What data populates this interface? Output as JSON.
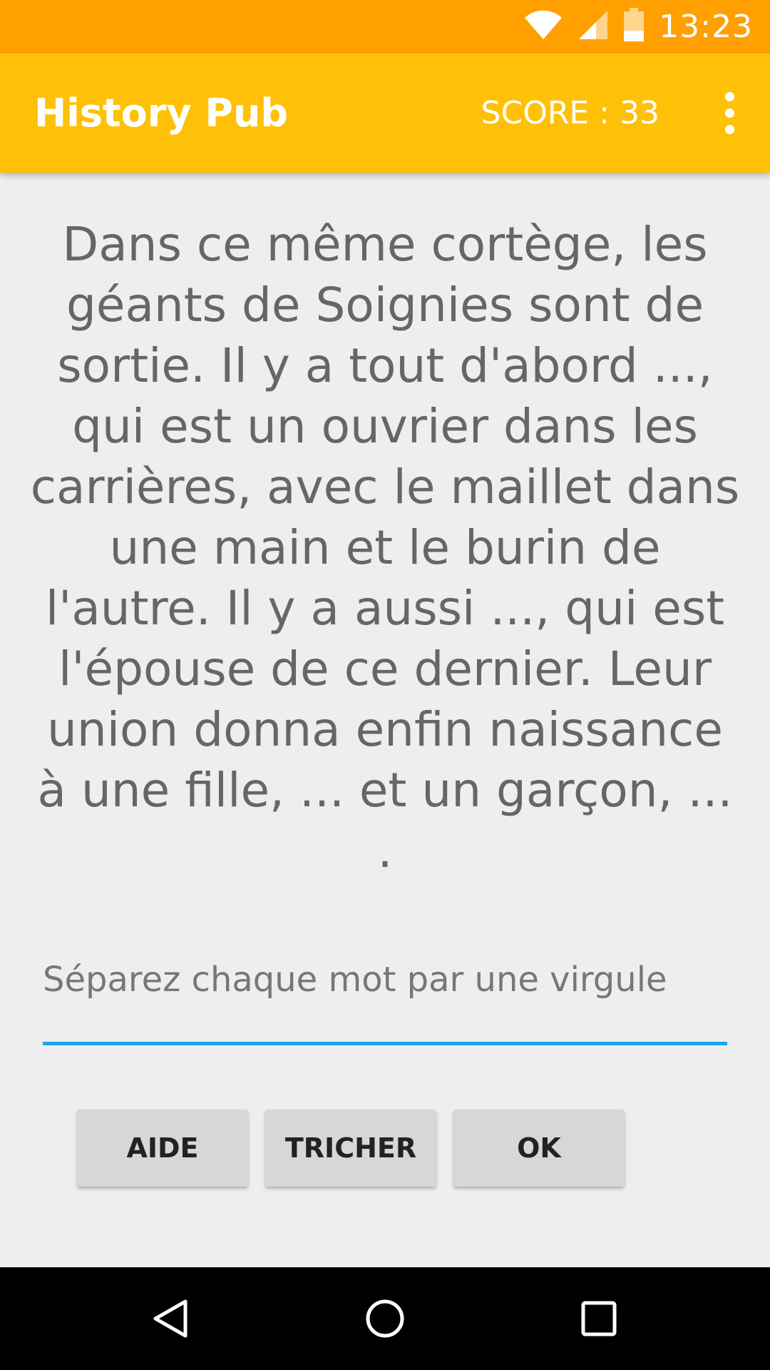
{
  "status_bar": {
    "time": "13:23",
    "icons": [
      "wifi-icon",
      "signal-icon",
      "battery-icon"
    ]
  },
  "app_bar": {
    "title": "History Pub",
    "score": "SCORE : 33",
    "menu_icon": "overflow-menu-icon"
  },
  "question": {
    "text": "Dans ce même cortège, les géants de Soignies sont de sortie. Il y a tout d'abord ..., qui est un ouvrier dans les carrières, avec le maillet dans une main et le burin de l'autre. Il y a aussi ..., qui est l'épouse de ce dernier. Leur union donna enfin naissance à une fille, ... et un garçon, ... ."
  },
  "answer": {
    "placeholder": "Séparez chaque mot par une virgule",
    "value": ""
  },
  "buttons": {
    "help": "AIDE",
    "cheat": "TRICHER",
    "ok": "OK"
  },
  "nav_bar": {
    "icons": [
      "back-icon",
      "home-icon",
      "recents-icon"
    ]
  },
  "colors": {
    "status_bar": "#ffa000",
    "app_bar": "#ffc107",
    "accent": "#1aa7ec",
    "background": "#eeeeee"
  }
}
